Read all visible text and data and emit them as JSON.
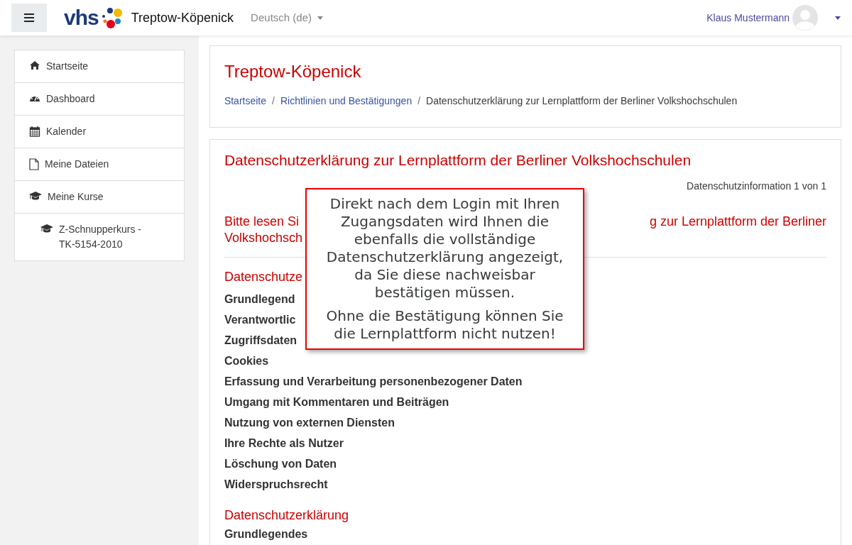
{
  "navbar": {
    "logo_text": "vhs",
    "brand": "Treptow-Köpenick",
    "language": "Deutsch (de)",
    "user": "Klaus Mustermann"
  },
  "sidebar": {
    "items": [
      {
        "label": "Startseite"
      },
      {
        "label": "Dashboard"
      },
      {
        "label": "Kalender"
      },
      {
        "label": "Meine Dateien"
      },
      {
        "label": "Meine Kurse",
        "children": [
          {
            "label": "Z-Schnupperkurs -\nTK-5154-2010"
          }
        ]
      }
    ]
  },
  "page_header": {
    "title": "Treptow-Köpenick",
    "separator": "/",
    "breadcrumb": [
      "Startseite",
      "Richtlinien und Bestätigungen",
      "Datenschutzerklärung zur Lernplattform der Berliner Volkshochschulen"
    ]
  },
  "policy": {
    "title": "Datenschutzerklärung zur Lernplattform der Berliner Volkshochschulen",
    "counter": "Datenschutzinformation 1 von 1",
    "intro_line_1_left": "Bitte lesen Si",
    "intro_line_1_right": "g zur Lernplattform der Berliner",
    "intro_line_2": "Volkshochsch",
    "contents": {
      "heading": "Datenschutze",
      "items": [
        "Grundlegend",
        "Verantwortlic",
        "Zugriffsdaten",
        "Cookies",
        "Erfassung und Verarbeitung personenbezogener Daten",
        "Umgang mit Kommentaren und Beiträgen",
        "Nutzung von externen Diensten",
        "Ihre Rechte als Nutzer",
        "Löschung von Daten",
        "Widerspruchsrecht"
      ]
    },
    "section": {
      "heading": "Datenschutzerklärung",
      "items": [
        "Grundlegendes"
      ]
    }
  },
  "callout": {
    "paragraphs": [
      [
        "Direkt nach dem Login mit Ihren",
        "Zugangsdaten wird Ihnen die",
        "ebenfalls die vollständige",
        "Datenschutzerklärung angezeigt,",
        "da Sie diese nachweisbar",
        "bestätigen müssen."
      ],
      [
        "Ohne die Bestätigung können Sie",
        "die Lernplattform nicht nutzen!"
      ]
    ]
  }
}
